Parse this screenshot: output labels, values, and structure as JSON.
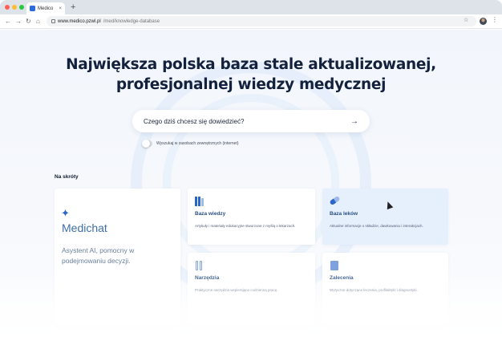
{
  "browser": {
    "tab": {
      "title": "Medico",
      "close": "×"
    },
    "new_tab": "+",
    "nav": {
      "back": "←",
      "forward": "→",
      "reload": "↻",
      "home": "⌂"
    },
    "url": {
      "domain": "www.medico.pzwl.pl",
      "path": "/med/knowledge-database"
    },
    "star": "☆",
    "menu": "⋮",
    "icons": [
      "close-icon",
      "back-icon",
      "forward-icon",
      "reload-icon",
      "home-icon",
      "lock-icon",
      "star-icon",
      "kebab-menu-icon"
    ]
  },
  "hero": {
    "title_line1": "Największa polska baza stale aktualizowanej,",
    "title_line2": "profesjonalnej wiedzy medycznej"
  },
  "search": {
    "placeholder": "Czego dziś chcesz się dowiedzieć?",
    "submit": "→",
    "toggle_label": "Wyszukaj w zasobach zewnętrznych (internet)",
    "toggle_on": false
  },
  "shortcuts": {
    "title": "Na skróty",
    "medichat": {
      "icon": "sparkle-icon",
      "glyph": "✦",
      "title": "Medichat",
      "description": "Asystent AI, pomocny w podejmowaniu decyzji."
    },
    "baza_wiedzy": {
      "icon": "books-icon",
      "title": "Baza wiedzy",
      "description": "Artykuły i materiały edukacyjne stworzone z myślą o lekarzach."
    },
    "baza_lekow": {
      "icon": "pill-icon",
      "title": "Baza leków",
      "description": "Aktualne informacje o składzie, dawkowaniu i interakcjach."
    },
    "narzedzia": {
      "icon": "tools-icon",
      "title": "Narzędzia",
      "description": "Praktyczne narzędzia wspierające codzienną pracę."
    },
    "zalecenia": {
      "icon": "document-icon",
      "title": "Zalecenia",
      "description": "Wytyczne dotyczące leczenia, profilaktyki i diagnostyki."
    }
  },
  "colors": {
    "accent": "#2a65c9",
    "title": "#13213d",
    "highlight_card": "#e6f0fc"
  }
}
